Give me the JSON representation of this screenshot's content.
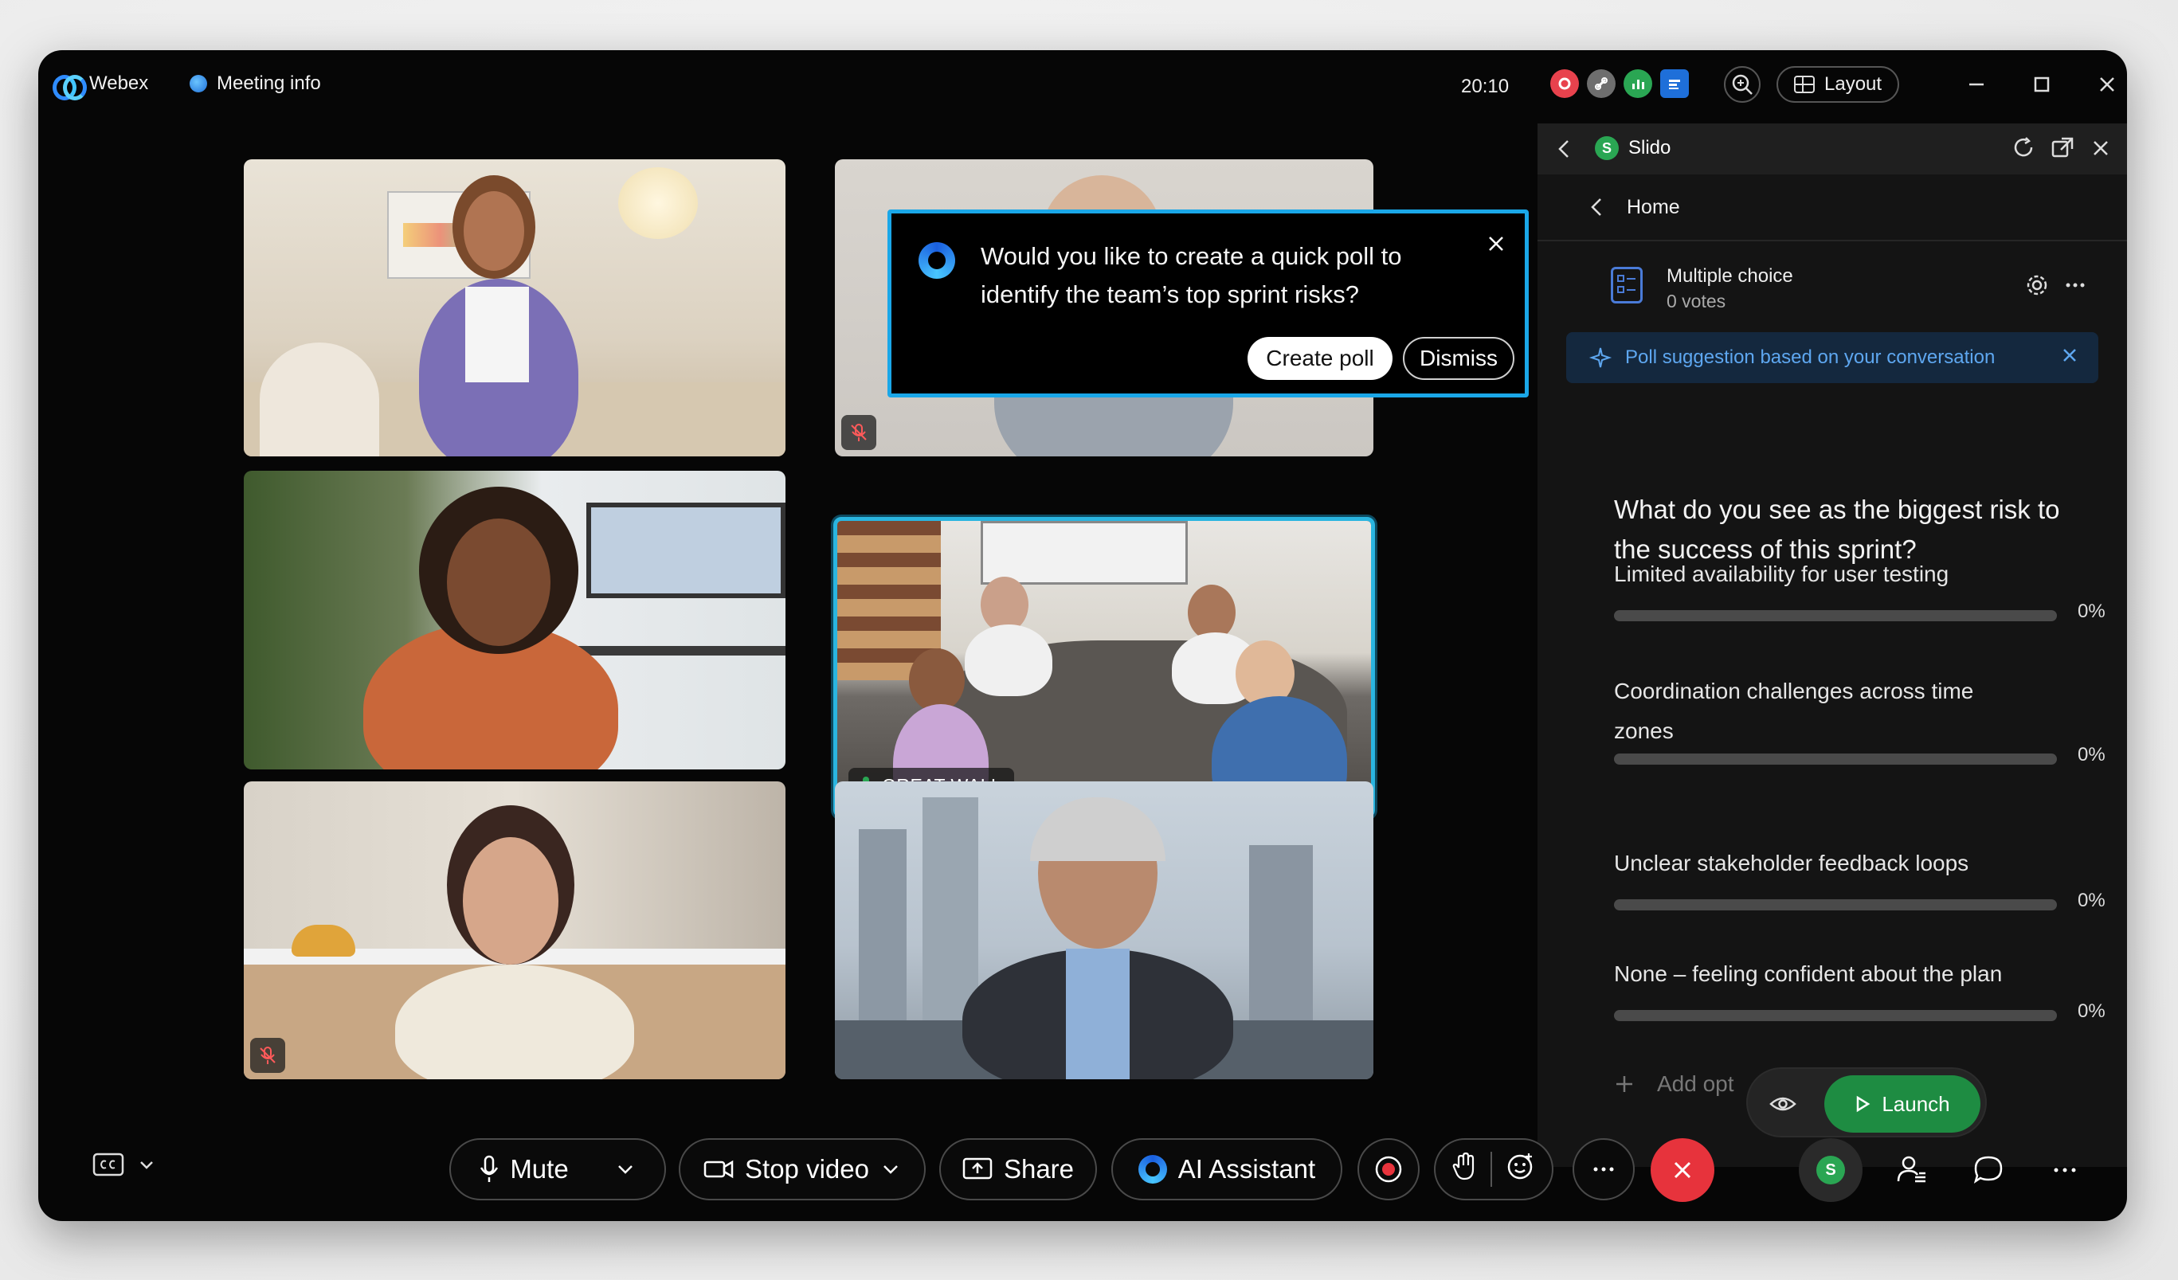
{
  "titlebar": {
    "app_name": "Webex",
    "meeting_info": "Meeting info",
    "time": "20:10",
    "layout_label": "Layout"
  },
  "tiles": {
    "great_wall_name": "GREAT WALL"
  },
  "popup": {
    "text": "Would you like to create a quick poll to identify the team’s top sprint risks?",
    "create_label": "Create poll",
    "dismiss_label": "Dismiss"
  },
  "panel": {
    "title": "Slido",
    "logo_letter": "S",
    "home_label": "Home",
    "poll_type": "Multiple choice",
    "votes": "0 votes",
    "suggestion": "Poll suggestion based on your conversation",
    "question": "What do you see as the biggest risk to the success of this sprint?",
    "options": [
      {
        "label": "Limited availability for user testing",
        "pct": "0%",
        "value": 0
      },
      {
        "label": "Coordination challenges across time zones",
        "pct": "0%",
        "value": 0
      },
      {
        "label": "Unclear stakeholder feedback loops",
        "pct": "0%",
        "value": 0
      },
      {
        "label": "None – feeling confident about the plan",
        "pct": "0%",
        "value": 0
      }
    ],
    "add_option": "Add opt",
    "launch_label": "Launch"
  },
  "toolbar": {
    "mute_label": "Mute",
    "stop_video_label": "Stop video",
    "share_label": "Share",
    "ai_assistant_label": "AI Assistant",
    "avatar_letter": "S"
  },
  "colors": {
    "accent_blue": "#1aa7e8",
    "slido_green": "#2aa653",
    "end_red": "#e7333c"
  }
}
